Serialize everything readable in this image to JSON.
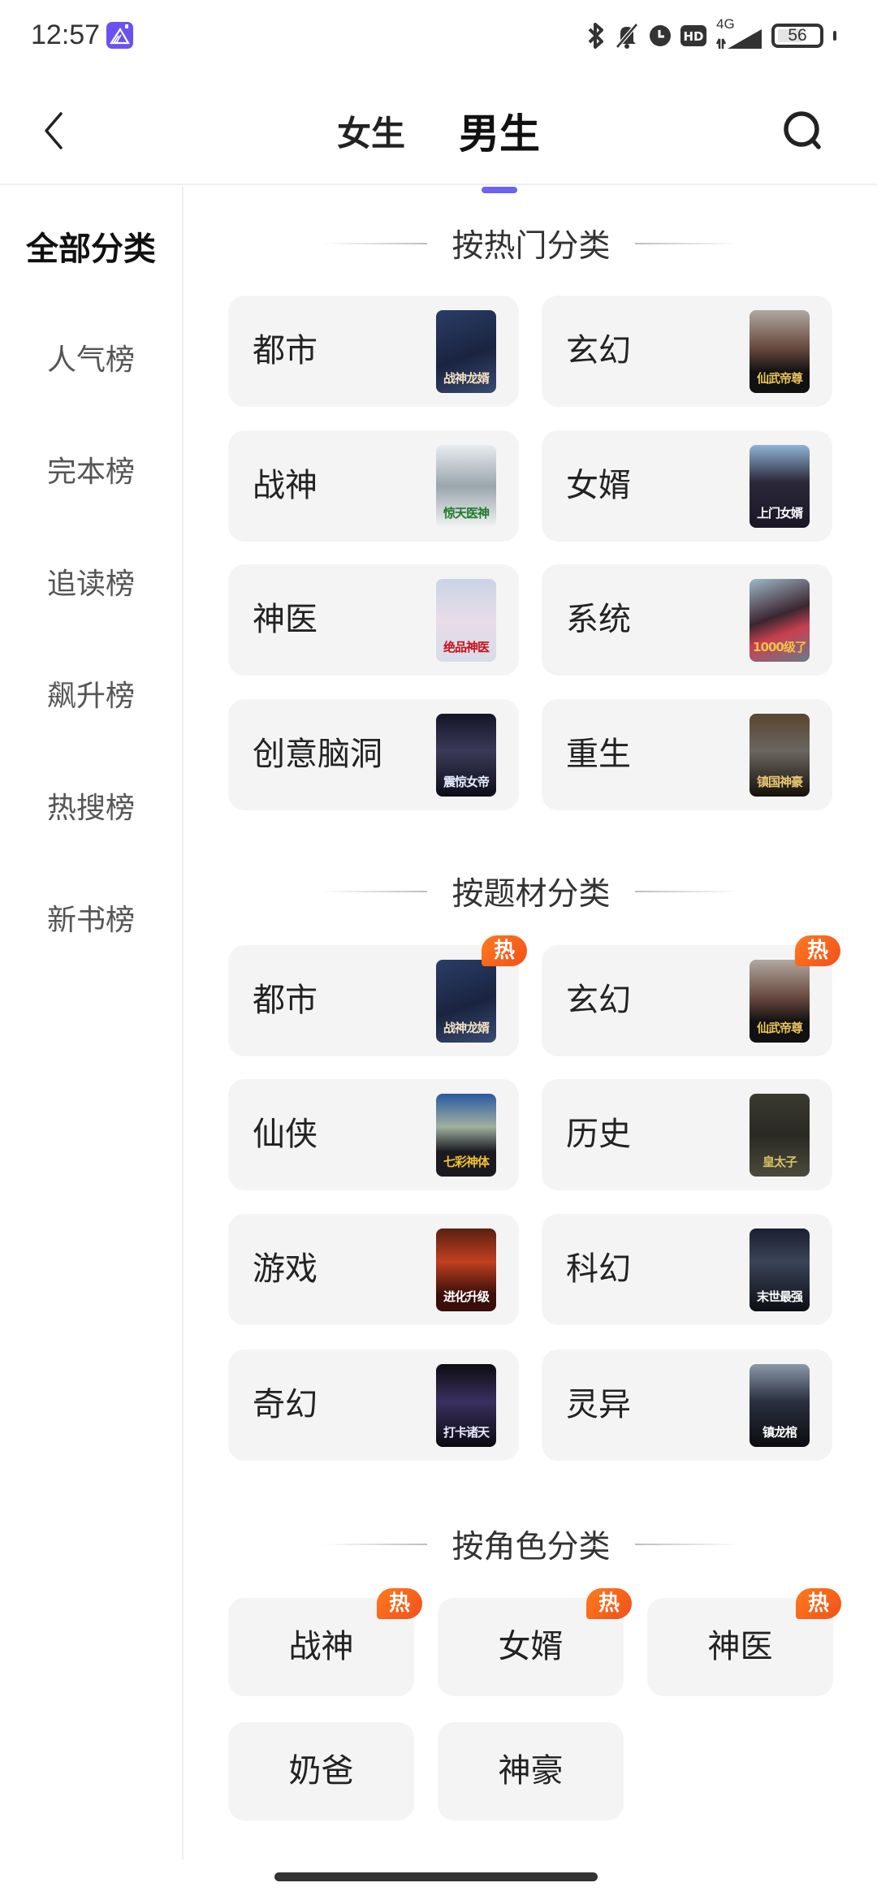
{
  "status_bar": {
    "time": "12:57",
    "app_icon": "mountain-app-icon",
    "icons": [
      "bluetooth-icon",
      "bell-muted-icon",
      "alarm-clock-icon",
      "hd-icon",
      "signal-4g-icon"
    ],
    "hd_label": "HD",
    "network": "4G",
    "battery": "56"
  },
  "header": {
    "back_icon": "chevron-left-icon",
    "tabs": [
      {
        "label": "女生",
        "active": false
      },
      {
        "label": "男生",
        "active": true
      }
    ],
    "search_icon": "search-icon",
    "accent_color": "#6e63f0"
  },
  "sidebar": {
    "items": [
      {
        "label": "全部分类",
        "active": true
      },
      {
        "label": "人气榜"
      },
      {
        "label": "完本榜"
      },
      {
        "label": "追读榜"
      },
      {
        "label": "飙升榜"
      },
      {
        "label": "热搜榜"
      },
      {
        "label": "新书榜"
      }
    ]
  },
  "sections": {
    "popular": {
      "title": "按热门分类",
      "items": [
        {
          "label": "都市",
          "cover": "战神龙婿"
        },
        {
          "label": "玄幻",
          "cover": "仙武帝尊"
        },
        {
          "label": "战神",
          "cover": "惊天医神"
        },
        {
          "label": "女婿",
          "cover": "上门女婿"
        },
        {
          "label": "神医",
          "cover": "绝品神医"
        },
        {
          "label": "系统",
          "cover": "1000级了"
        },
        {
          "label": "创意脑洞",
          "cover": "震惊女帝"
        },
        {
          "label": "重生",
          "cover": "镇国神豪"
        }
      ]
    },
    "theme": {
      "title": "按题材分类",
      "hot_label": "热",
      "items": [
        {
          "label": "都市",
          "cover": "战神龙婿",
          "hot": true
        },
        {
          "label": "玄幻",
          "cover": "仙武帝尊",
          "hot": true
        },
        {
          "label": "仙侠",
          "cover": "七彩神体"
        },
        {
          "label": "历史",
          "cover": "皇太子"
        },
        {
          "label": "游戏",
          "cover": "进化升级"
        },
        {
          "label": "科幻",
          "cover": "末世最强"
        },
        {
          "label": "奇幻",
          "cover": "打卡诸天"
        },
        {
          "label": "灵异",
          "cover": "镇龙棺"
        }
      ]
    },
    "role": {
      "title": "按角色分类",
      "hot_label": "热",
      "items": [
        {
          "label": "战神",
          "hot": true
        },
        {
          "label": "女婿",
          "hot": true
        },
        {
          "label": "神医",
          "hot": true
        },
        {
          "label": "奶爸"
        },
        {
          "label": "神豪"
        }
      ]
    }
  }
}
